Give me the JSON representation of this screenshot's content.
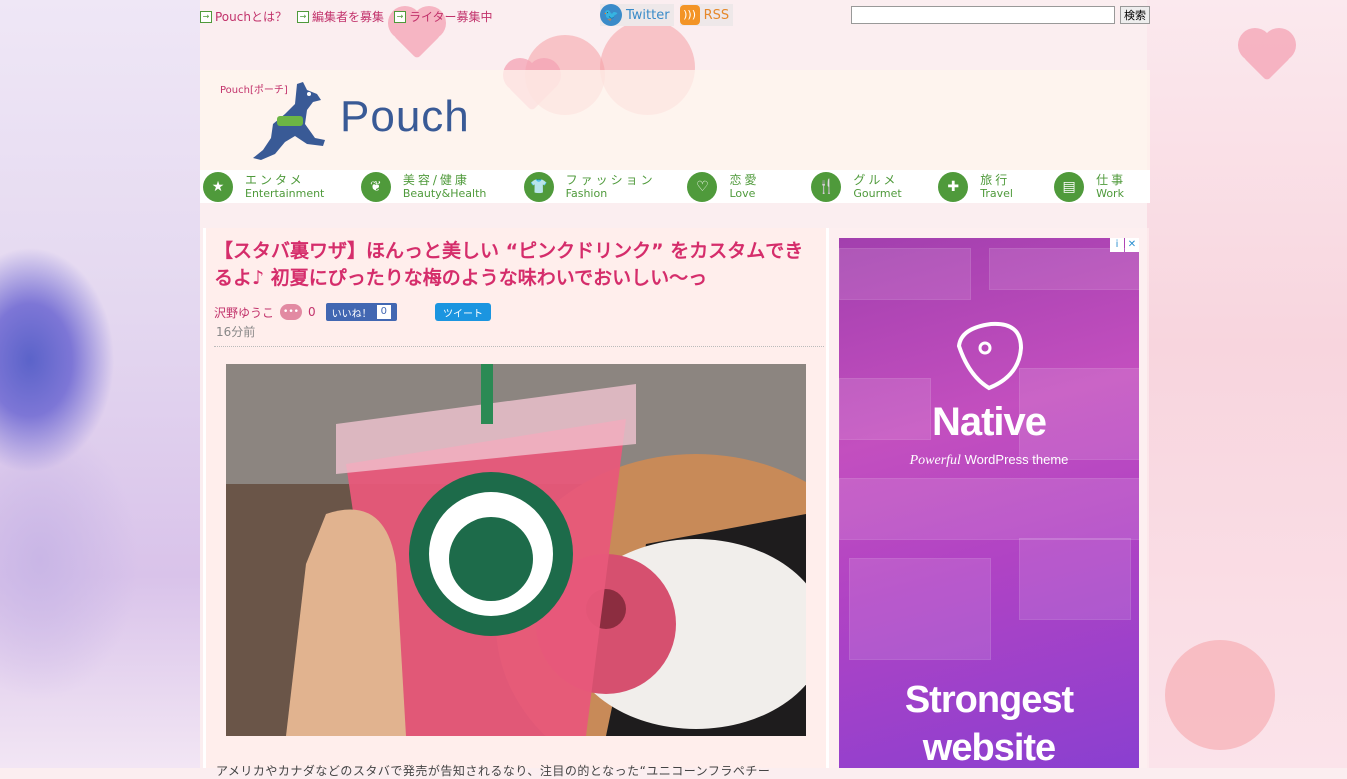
{
  "toplinks": [
    {
      "label": "Pouchとは？"
    },
    {
      "label": "編集者を募集"
    },
    {
      "label": "ライター募集中"
    }
  ],
  "social": {
    "twitter": "Twitter",
    "rss": "RSS"
  },
  "search": {
    "button": "検索",
    "value": ""
  },
  "logo": {
    "sub": "Pouch[ポーチ]",
    "name": "Pouch"
  },
  "nav": [
    {
      "jp": "エンタメ",
      "en": "Entertainment",
      "icon": "star-icon"
    },
    {
      "jp": "美容/健康",
      "en": "Beauty&Health",
      "icon": "leaf-icon"
    },
    {
      "jp": "ファッション",
      "en": "Fashion",
      "icon": "shirt-icon"
    },
    {
      "jp": "恋愛",
      "en": "Love",
      "icon": "heart-icon"
    },
    {
      "jp": "グルメ",
      "en": "Gourmet",
      "icon": "fork-knife-icon"
    },
    {
      "jp": "旅行",
      "en": "Travel",
      "icon": "globe-icon"
    },
    {
      "jp": "仕事",
      "en": "Work",
      "icon": "notebook-icon"
    }
  ],
  "article": {
    "title": "【スタバ裏ワザ】ほんっと美しい “ピンクドリンク” をカスタムできるよ♪ 初夏にぴったりな梅のような味わいでおいしい〜っ",
    "author": "沢野ゆうこ",
    "comments": "0",
    "like_label": "いいね！",
    "like_count": "0",
    "tweet_label": "ツイート",
    "time": "16分前",
    "body_start": "アメリカやカナダなどのスタバで発売が告知されるなり、注目の的となった“ユニコーンフラペチー"
  },
  "ad": {
    "badge_info": "i",
    "badge_close": "✕",
    "brand": "Native",
    "tagline_em": "Powerful",
    "tagline_rest": "WordPress theme",
    "headline_line1": "Strongest",
    "headline_line2": "website"
  },
  "colors": {
    "accent": "#d52d6b",
    "nav_green": "#4f9a3b",
    "logo_blue": "#395a96"
  }
}
